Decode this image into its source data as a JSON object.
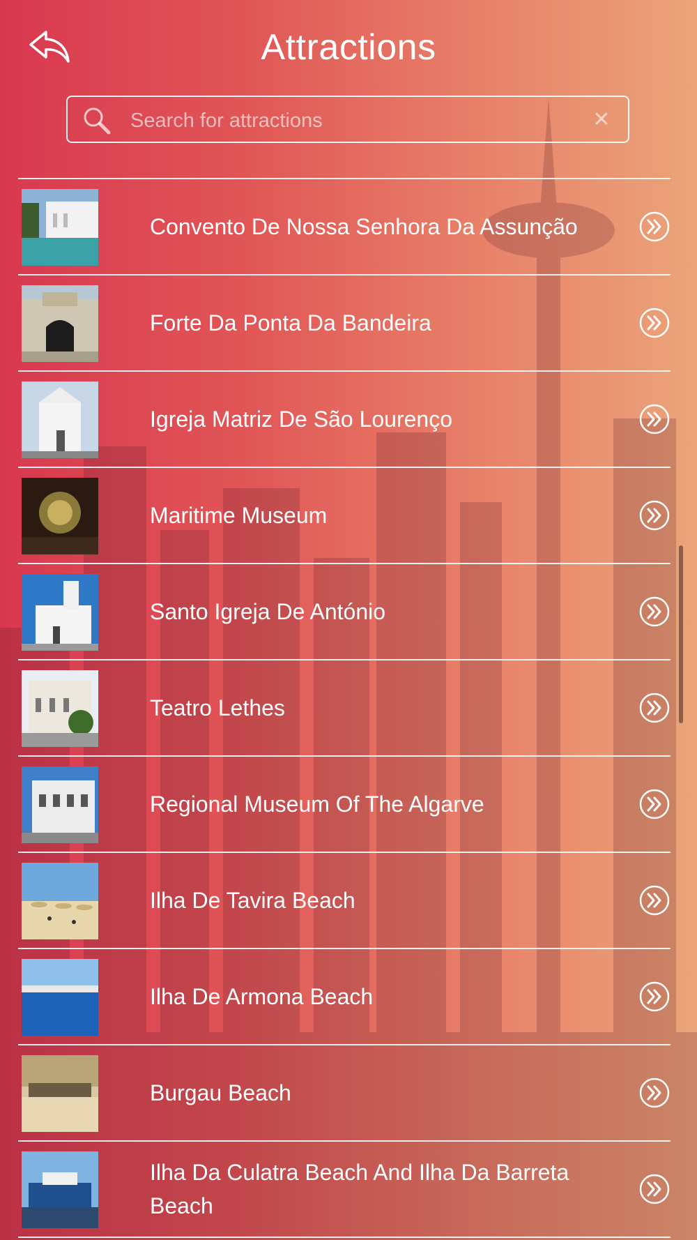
{
  "header": {
    "title": "Attractions",
    "back_icon": "back-arrow-icon"
  },
  "search": {
    "placeholder": "Search for attractions",
    "value": "",
    "icon": "search-icon",
    "clear_glyph": "✕"
  },
  "attractions": [
    {
      "label": "Convento De Nossa Senhora Da Assunção",
      "thumb": "white-building-pool"
    },
    {
      "label": "Forte Da Ponta Da Bandeira",
      "thumb": "stone-fort-gate"
    },
    {
      "label": "Igreja Matriz De São Lourenço",
      "thumb": "white-church"
    },
    {
      "label": "Maritime Museum",
      "thumb": "museum-interior"
    },
    {
      "label": "Santo Igreja De António",
      "thumb": "white-church-blue-sky"
    },
    {
      "label": "Teatro Lethes",
      "thumb": "theatre-facade"
    },
    {
      "label": "Regional Museum Of The Algarve",
      "thumb": "museum-building"
    },
    {
      "label": "Ilha De Tavira Beach",
      "thumb": "beach-umbrellas"
    },
    {
      "label": "Ilha De Armona Beach",
      "thumb": "sea-coast"
    },
    {
      "label": "Burgau Beach",
      "thumb": "beach-cliff"
    },
    {
      "label": "Ilha Da Culatra Beach And Ilha Da Barreta Beach",
      "thumb": "boat-harbour"
    }
  ],
  "colors": {
    "gradient_left": "#d8384f",
    "gradient_right": "#eba479",
    "text": "#ffffff"
  },
  "row_icon": "chevron-double-right-icon"
}
